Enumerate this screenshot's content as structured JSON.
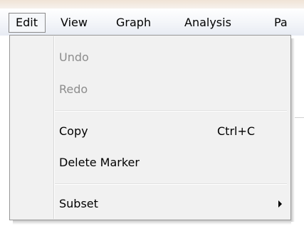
{
  "menubar": {
    "items": [
      {
        "label": "Edit",
        "active": true
      },
      {
        "label": "View"
      },
      {
        "label": "Graph"
      },
      {
        "label": "Analysis"
      },
      {
        "label": "Pa"
      }
    ]
  },
  "edit_menu": {
    "items": [
      {
        "label": "Undo",
        "enabled": false
      },
      {
        "label": "Redo",
        "enabled": false
      },
      {
        "label": "Copy",
        "shortcut": "Ctrl+C",
        "enabled": true
      },
      {
        "label": "Delete Marker",
        "enabled": true
      },
      {
        "label": "Subset",
        "has_submenu": true,
        "enabled": true
      }
    ]
  },
  "colors": {
    "menu_background": "#f1f1f1",
    "disabled_text": "#8c8c8c",
    "menu_border": "#979797"
  }
}
